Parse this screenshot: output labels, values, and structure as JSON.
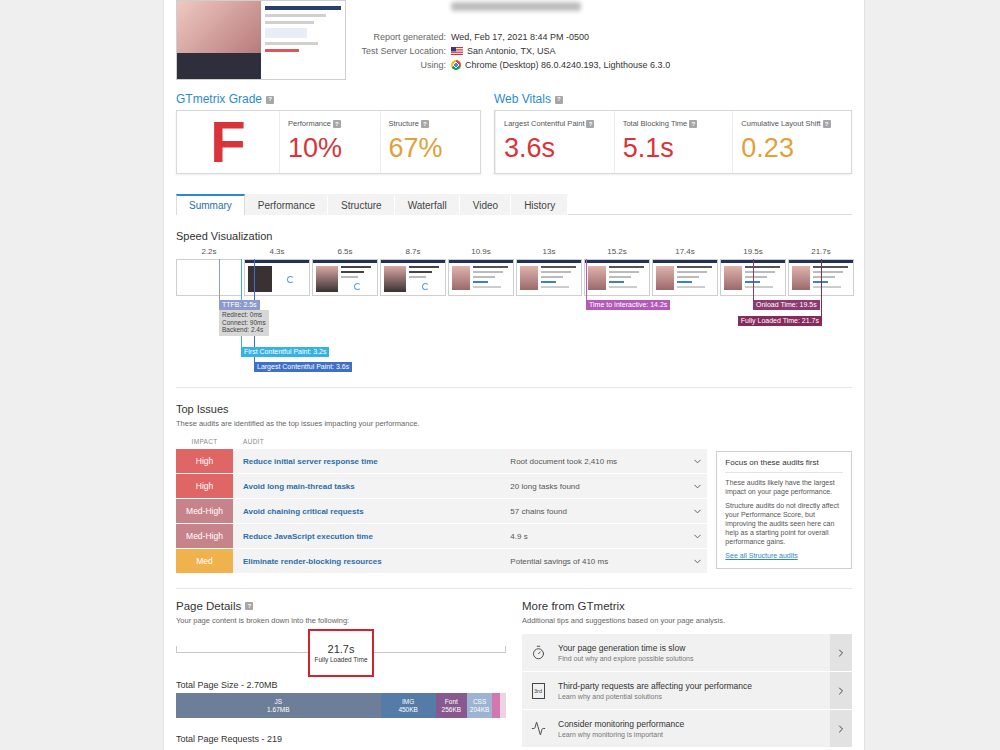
{
  "report": {
    "rows": [
      {
        "label": "Report generated:",
        "value": "Wed, Feb 17, 2021 8:44 PM -0500",
        "kind": "plain"
      },
      {
        "label": "Test Server Location:",
        "value": "San Antonio, TX, USA",
        "kind": "flag"
      },
      {
        "label": "Using:",
        "value": "Chrome (Desktop) 86.0.4240.193, Lighthouse 6.3.0",
        "kind": "browser"
      }
    ]
  },
  "grade": {
    "title": "GTmetrix Grade",
    "help": "?",
    "letter": "F",
    "color": "#d9343a",
    "metrics": [
      {
        "label": "Performance",
        "help": "?",
        "value": "10%",
        "color": "#d9343a"
      },
      {
        "label": "Structure",
        "help": "?",
        "value": "67%",
        "color": "#e3a03a"
      }
    ]
  },
  "web_vitals": {
    "title": "Web Vitals",
    "help": "?",
    "metrics": [
      {
        "label": "Largest Contentful Paint",
        "help": "?",
        "value": "3.6s",
        "color": "#d9343a"
      },
      {
        "label": "Total Blocking Time",
        "help": "?",
        "value": "5.1s",
        "color": "#d9343a"
      },
      {
        "label": "Cumulative Layout Shift",
        "help": "?",
        "value": "0.23",
        "color": "#e3a03a"
      }
    ]
  },
  "tabs": [
    {
      "label": "Summary",
      "selected": true
    },
    {
      "label": "Performance",
      "selected": false
    },
    {
      "label": "Structure",
      "selected": false
    },
    {
      "label": "Waterfall",
      "selected": false
    },
    {
      "label": "Video",
      "selected": false
    },
    {
      "label": "History",
      "selected": false
    }
  ],
  "speed_visualization": {
    "title": "Speed Visualization",
    "ticks": [
      "2.2s",
      "4.3s",
      "6.5s",
      "8.7s",
      "10.9s",
      "13s",
      "15.2s",
      "17.4s",
      "19.5s",
      "21.7s"
    ],
    "frames": [
      {
        "kind": "blank"
      },
      {
        "kind": "loading"
      },
      {
        "kind": "partial"
      },
      {
        "kind": "partial"
      },
      {
        "kind": "full"
      },
      {
        "kind": "full"
      },
      {
        "kind": "full"
      },
      {
        "kind": "full"
      },
      {
        "kind": "full"
      },
      {
        "kind": "full"
      }
    ],
    "markers": [
      {
        "label": "TTFB: 2.5s",
        "time": 2.5,
        "color": "#8d9acb",
        "details": [
          "Redirect: 0ms",
          "Connect: 90ms",
          "Backend: 2.4s"
        ]
      },
      {
        "label": "First Contentful Paint: 3.2s",
        "time": 3.2,
        "color": "#35b3e4",
        "details": []
      },
      {
        "label": "Largest Contentful Paint: 3.6s",
        "time": 3.6,
        "color": "#3d70c6",
        "details": []
      },
      {
        "label": "Time to Interactive: 14.2s",
        "time": 14.2,
        "color": "#b35ab8",
        "details": []
      },
      {
        "label": "Onload Time: 19.5s",
        "time": 19.5,
        "color": "#8e3a70",
        "details": []
      },
      {
        "label": "Fully Loaded Time: 21.7s",
        "time": 21.7,
        "color": "#862a5c",
        "details": []
      }
    ]
  },
  "top_issues": {
    "title": "Top Issues",
    "subtitle": "These audits are identified as the top issues impacting your performance.",
    "columns": [
      "IMPACT",
      "AUDIT"
    ],
    "rows": [
      {
        "impact": "High",
        "color": "#e06666",
        "audit": "Reduce initial server response time",
        "detail": "Root document took 2,410 ms",
        "expanded": false
      },
      {
        "impact": "High",
        "color": "#e06666",
        "audit": "Avoid long main-thread tasks",
        "detail": "20 long tasks found",
        "expanded": false
      },
      {
        "impact": "Med-High",
        "color": "#c7838a",
        "audit": "Avoid chaining critical requests",
        "detail": "57 chains found",
        "expanded": false
      },
      {
        "impact": "Med-High",
        "color": "#c7838a",
        "audit": "Reduce JavaScript execution time",
        "detail": "4.9 s",
        "expanded": false
      },
      {
        "impact": "Med",
        "color": "#efb24d",
        "audit": "Eliminate render-blocking resources",
        "detail": "Potential savings of 410 ms",
        "expanded": false
      }
    ],
    "focus": {
      "title": "Focus on these audits first",
      "paragraphs": [
        "These audits likely have the largest impact on your page performance.",
        "Structure audits do not directly affect your Performance Score, but improving the audits seen here can help as a starting point for overall performance gains."
      ],
      "link": "See all Structure audits"
    }
  },
  "page_details": {
    "title": "Page Details",
    "help": "?",
    "subtitle": "Your page content is broken down into the following:",
    "fully_loaded": {
      "value": "21.7s",
      "label": "Fully Loaded Time"
    },
    "size": {
      "title": "Total Page Size - 2.70MB",
      "segments": [
        {
          "label": "JS",
          "size": "1.67MB",
          "level": 0.62,
          "color": "#6d7f98"
        },
        {
          "label": "IMG",
          "size": "450KB",
          "level": 0.167,
          "color": "#557ca6"
        },
        {
          "label": "Font",
          "size": "256KB",
          "level": 0.095,
          "color": "#87598f"
        },
        {
          "label": "CSS",
          "size": "204KB",
          "level": 0.076,
          "color": "#9cb3d3"
        },
        {
          "level": 0.024,
          "color": "#d477ae"
        },
        {
          "level": 0.018,
          "color": "#ead3e3"
        }
      ]
    },
    "requests": {
      "title": "Total Page Requests - 219"
    }
  },
  "more": {
    "title": "More from GTmetrix",
    "subtitle": "Additional tips and suggestions based on your page analysis.",
    "items": [
      {
        "kind": "timer",
        "title": "Your page generation time is slow",
        "subtitle": "Find out why and explore possible solutions"
      },
      {
        "kind": "third-party",
        "badge": "3rd",
        "title": "Third-party requests are affecting your performance",
        "subtitle": "Learn why and potential solutions"
      },
      {
        "kind": "monitor",
        "title": "Consider monitoring performance",
        "subtitle": "Learn why monitoring is important"
      }
    ]
  }
}
